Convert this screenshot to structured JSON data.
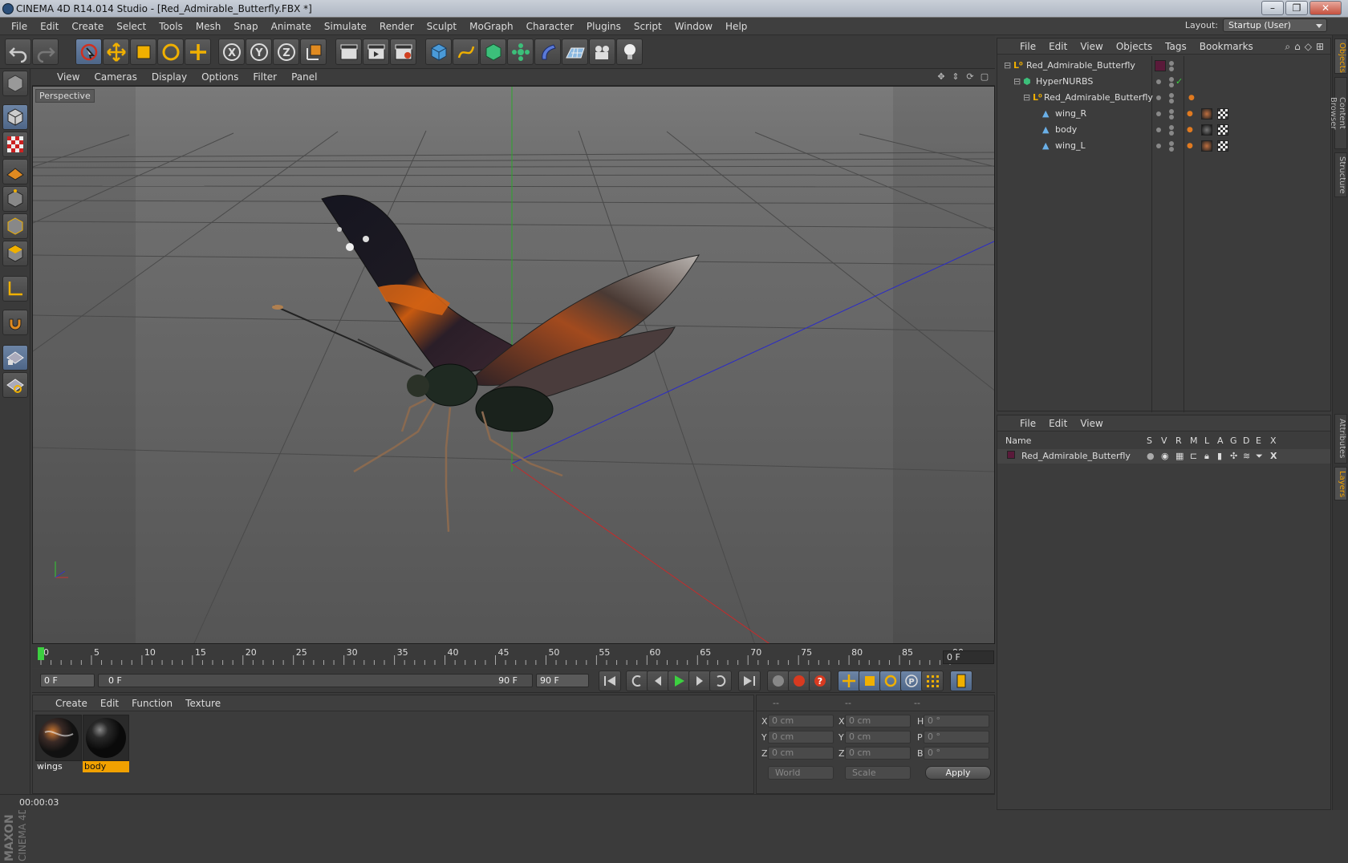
{
  "window": {
    "title": "CINEMA 4D R14.014 Studio - [Red_Admirable_Butterfly.FBX *]"
  },
  "menubar": {
    "items": [
      "File",
      "Edit",
      "Create",
      "Select",
      "Tools",
      "Mesh",
      "Snap",
      "Animate",
      "Simulate",
      "Render",
      "Sculpt",
      "MoGraph",
      "Character",
      "Plugins",
      "Script",
      "Window",
      "Help"
    ]
  },
  "layout": {
    "label": "Layout:",
    "value": "Startup (User)"
  },
  "viewport": {
    "menu": [
      "View",
      "Cameras",
      "Display",
      "Options",
      "Filter",
      "Panel"
    ],
    "label": "Perspective"
  },
  "timeline": {
    "ticks": [
      "0",
      "5",
      "10",
      "15",
      "20",
      "25",
      "30",
      "35",
      "40",
      "45",
      "50",
      "55",
      "60",
      "65",
      "70",
      "75",
      "80",
      "85",
      "90"
    ],
    "current_frame": "0 F"
  },
  "transport": {
    "start": "0 F",
    "range_start": "0 F",
    "range_end": "90 F",
    "end": "90 F"
  },
  "materials": {
    "menu": [
      "Create",
      "Edit",
      "Function",
      "Texture"
    ],
    "items": [
      {
        "name": "wings"
      },
      {
        "name": "body"
      }
    ]
  },
  "coords": {
    "headers": [
      "--",
      "--",
      "--"
    ],
    "pos": {
      "x": "0 cm",
      "y": "0 cm",
      "z": "0 cm"
    },
    "size": {
      "x": "0 cm",
      "y": "0 cm",
      "z": "0 cm"
    },
    "rot": {
      "h": "0 °",
      "p": "0 °",
      "b": "0 °"
    },
    "labels": {
      "x": "X",
      "y": "Y",
      "z": "Z",
      "h": "H",
      "p": "P",
      "b": "B"
    },
    "mode1": "World",
    "mode2": "Scale",
    "apply": "Apply"
  },
  "status": {
    "time": "00:00:03"
  },
  "objects": {
    "menu": [
      "File",
      "Edit",
      "View",
      "Objects",
      "Tags",
      "Bookmarks"
    ],
    "tree": [
      {
        "name": "Red_Admirable_Butterfly"
      },
      {
        "name": "HyperNURBS"
      },
      {
        "name": "Red_Admirable_Butterfly"
      },
      {
        "name": "wing_R"
      },
      {
        "name": "body"
      },
      {
        "name": "wing_L"
      }
    ]
  },
  "layers": {
    "menu": [
      "File",
      "Edit",
      "View"
    ],
    "columns": [
      "Name",
      "S",
      "V",
      "R",
      "M",
      "L",
      "A",
      "G",
      "D",
      "E",
      "X"
    ],
    "rows": [
      {
        "name": "Red_Admirable_Butterfly"
      }
    ]
  },
  "side_tabs": [
    "Objects",
    "Content Browser",
    "Structure",
    "Attributes",
    "Layers"
  ],
  "brand": {
    "line1": "MAXON",
    "line2": "CINEMA 4D"
  },
  "colors": {
    "accent": "#f1a100",
    "active_blue": "#5a7396",
    "layer_color": "#5a1a3a"
  }
}
